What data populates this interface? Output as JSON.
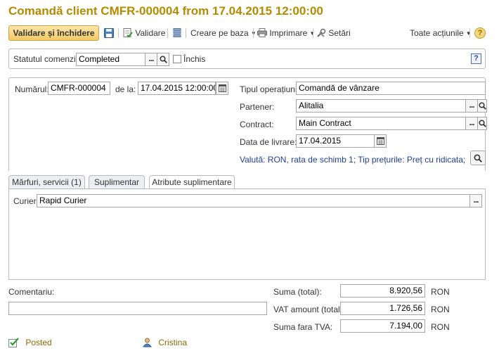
{
  "window": {
    "title": "Comandă client CMFR-000004 from 17.04.2015 12:00:00"
  },
  "toolbar": {
    "save_close_label": "Validare și închidere",
    "validate_label": "Validare",
    "create_based_label": "Creare pe baza",
    "print_label": "Imprimare",
    "settings_label": "Setări",
    "all_actions_label": "Toate acțiunile",
    "help_label": "?"
  },
  "status": {
    "label": "Statutul comenzii:",
    "value": "Completed",
    "closed_label": "Închis",
    "closed_checked": false,
    "help_label": "?"
  },
  "header": {
    "number_label": "Numărul:",
    "number_value": "CMFR-000004",
    "date_label": "de la:",
    "date_value": "17.04.2015 12:00:00",
    "operation_type_label": "Tipul operațiunii:",
    "operation_type_value": "Comandă de vânzare",
    "partner_label": "Partener:",
    "partner_value": "Alitalia",
    "contract_label": "Contract:",
    "contract_value": "Main Contract",
    "delivery_date_label": "Data de livrare:",
    "delivery_date_value": "17.04.2015",
    "currency_info": "Valută: RON, rata de schimb 1; Tip prețurile: Preț cu ridicata; Se i..."
  },
  "tabs": [
    {
      "label": "Mărfuri, servicii (1)",
      "active": false
    },
    {
      "label": "Suplimentar",
      "active": false
    },
    {
      "label": "Atribute suplimentare",
      "active": true
    }
  ],
  "attributes": {
    "courier_label": "Curier:",
    "courier_value": "Rapid Curier"
  },
  "comment": {
    "label": "Comentariu:",
    "value": ""
  },
  "totals": {
    "total_label": "Suma (total):",
    "total_value": "8.920,56",
    "vat_label": "VAT amount (total):",
    "vat_value": "1.726,56",
    "net_label": "Suma fara TVA:",
    "net_value": "7.194,00",
    "currency": "RON"
  },
  "footer": {
    "status_text": "Posted",
    "author_text": "Cristina"
  },
  "icons": {
    "save": "floppy-disk-icon",
    "validate": "post-document-icon",
    "structure": "document-structure-icon",
    "print": "printer-icon",
    "settings": "settings-tools-icon",
    "search": "magnifier-icon",
    "calendar": "calendar-icon",
    "posted": "posted-check-icon",
    "user": "user-icon"
  }
}
